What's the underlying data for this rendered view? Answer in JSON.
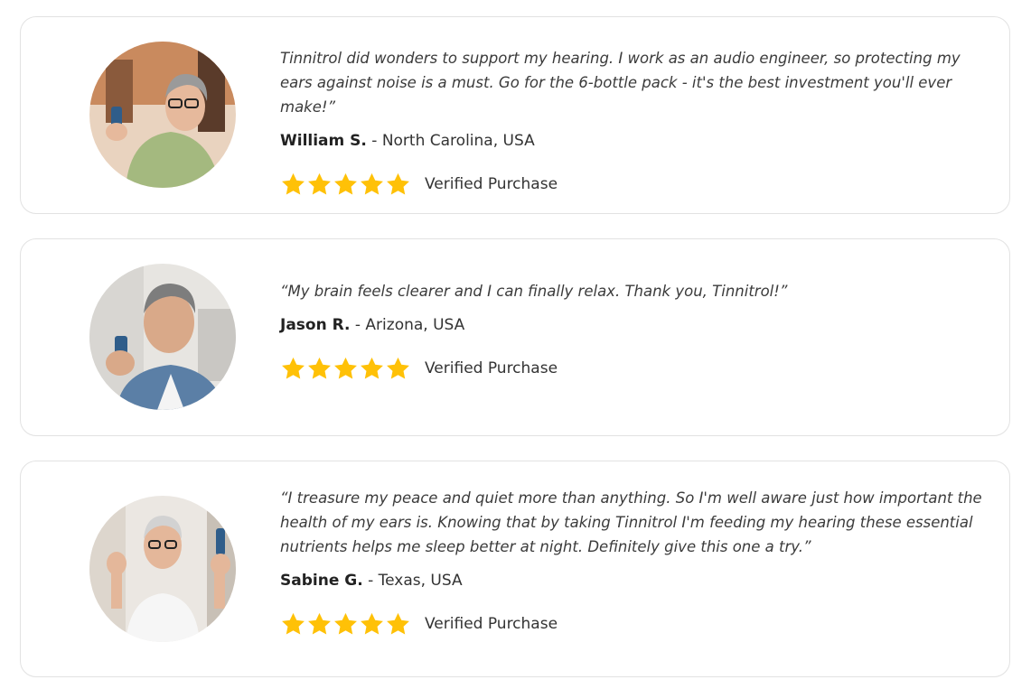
{
  "colors": {
    "star": "#FFC107",
    "card_border": "#E2E2E2",
    "text": "#333333"
  },
  "reviews": [
    {
      "quote": "Tinnitrol did wonders to support my hearing. I work as an audio engineer, so protecting my ears against noise is a must. Go for the 6-bottle pack - it's the best investment you'll ever make!”",
      "name": "William S.",
      "location": " - North Carolina, USA",
      "rating": 5,
      "verified": "Verified Purchase"
    },
    {
      "quote": "“My brain feels clearer and I can finally relax. Thank you, Tinnitrol!”",
      "name": "Jason R.",
      "location": " - Arizona, USA",
      "rating": 5,
      "verified": "Verified Purchase"
    },
    {
      "quote": "“I treasure my peace and quiet more than anything. So I'm well aware just how important the health of my ears is. Knowing that by taking Tinnitrol I'm feeding my hearing these essential nutrients helps me sleep better at night. Definitely give this one a try.”",
      "name": "Sabine G.",
      "location": " - Texas, USA",
      "rating": 5,
      "verified": "Verified Purchase"
    }
  ]
}
